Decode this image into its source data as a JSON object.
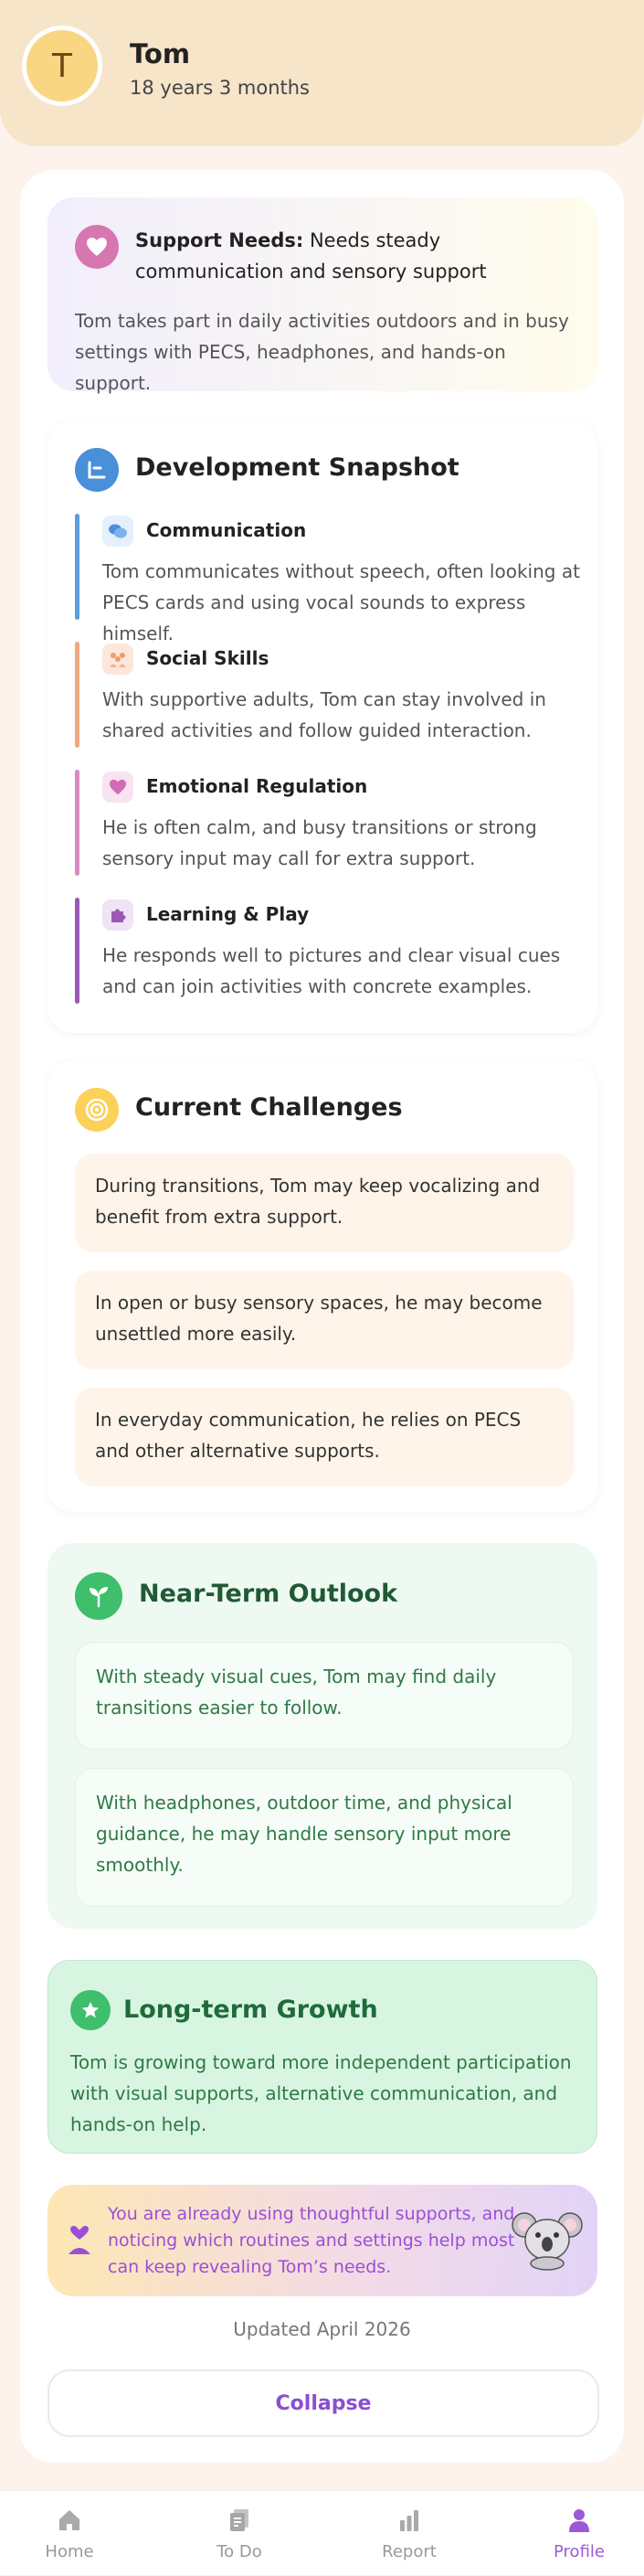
{
  "profile": {
    "initial": "T",
    "name": "Tom",
    "age": "18 years 3 months"
  },
  "support": {
    "label": "Support Needs:",
    "value": "Needs steady communication and sensory support",
    "description": "Tom takes part in daily activities outdoors and in busy settings with PECS, headphones, and hands-on support.",
    "icon": "heart-icon"
  },
  "development": {
    "title": "Development Snapshot",
    "icon": "chart-icon",
    "items": [
      {
        "title": "Communication",
        "description": "Tom communicates without speech, often looking at PECS cards and using vocal sounds to express himself.",
        "icon": "chat-bubbles-icon",
        "color": "#5b9ee0"
      },
      {
        "title": "Social Skills",
        "description": "With supportive adults, Tom can stay involved in shared activities and follow guided interaction.",
        "icon": "people-icon",
        "color": "#f2a983"
      },
      {
        "title": "Emotional Regulation",
        "description": "He is often calm, and busy transitions or strong sensory input may call for extra support.",
        "icon": "heart-icon",
        "color": "#d88cc4"
      },
      {
        "title": "Learning & Play",
        "description": "He responds well to pictures and clear visual cues and can join activities with concrete examples.",
        "icon": "puzzle-icon",
        "color": "#9b59b6"
      }
    ]
  },
  "challenges": {
    "title": "Current Challenges",
    "icon": "target-icon",
    "items": [
      "During transitions, Tom may keep vocalizing and benefit from extra support.",
      "In open or busy sensory spaces, he may become unsettled more easily.",
      "In everyday communication, he relies on PECS and other alternative supports."
    ]
  },
  "outlook": {
    "title": "Near-Term Outlook",
    "icon": "sprout-icon",
    "items": [
      "With steady visual cues, Tom may find daily transitions easier to follow.",
      "With headphones, outdoor time, and physical guidance, he may handle sensory input more smoothly."
    ]
  },
  "growth": {
    "title": "Long-term Growth",
    "icon": "star-icon",
    "description": "Tom is growing toward more independent participation with visual supports, alternative communication, and hands-on help."
  },
  "encouragement": {
    "text": "You are already using thoughtful supports, and noticing which routines and settings help most can keep revealing Tom’s needs.",
    "icon": "heart-person-icon",
    "mascot": "koala-icon"
  },
  "updated": "Updated April 2026",
  "collapse_label": "Collapse",
  "tabs": [
    {
      "label": "Home",
      "icon": "home-icon",
      "active": false
    },
    {
      "label": "To Do",
      "icon": "todo-icon",
      "active": false
    },
    {
      "label": "Report",
      "icon": "report-icon",
      "active": false
    },
    {
      "label": "Profile",
      "icon": "profile-icon",
      "active": true
    }
  ],
  "colors": {
    "accent": "#9b59d6",
    "header_bg": "#f6e5c9",
    "page_bg": "#fdf3ec",
    "green": "#3fbe6c"
  }
}
